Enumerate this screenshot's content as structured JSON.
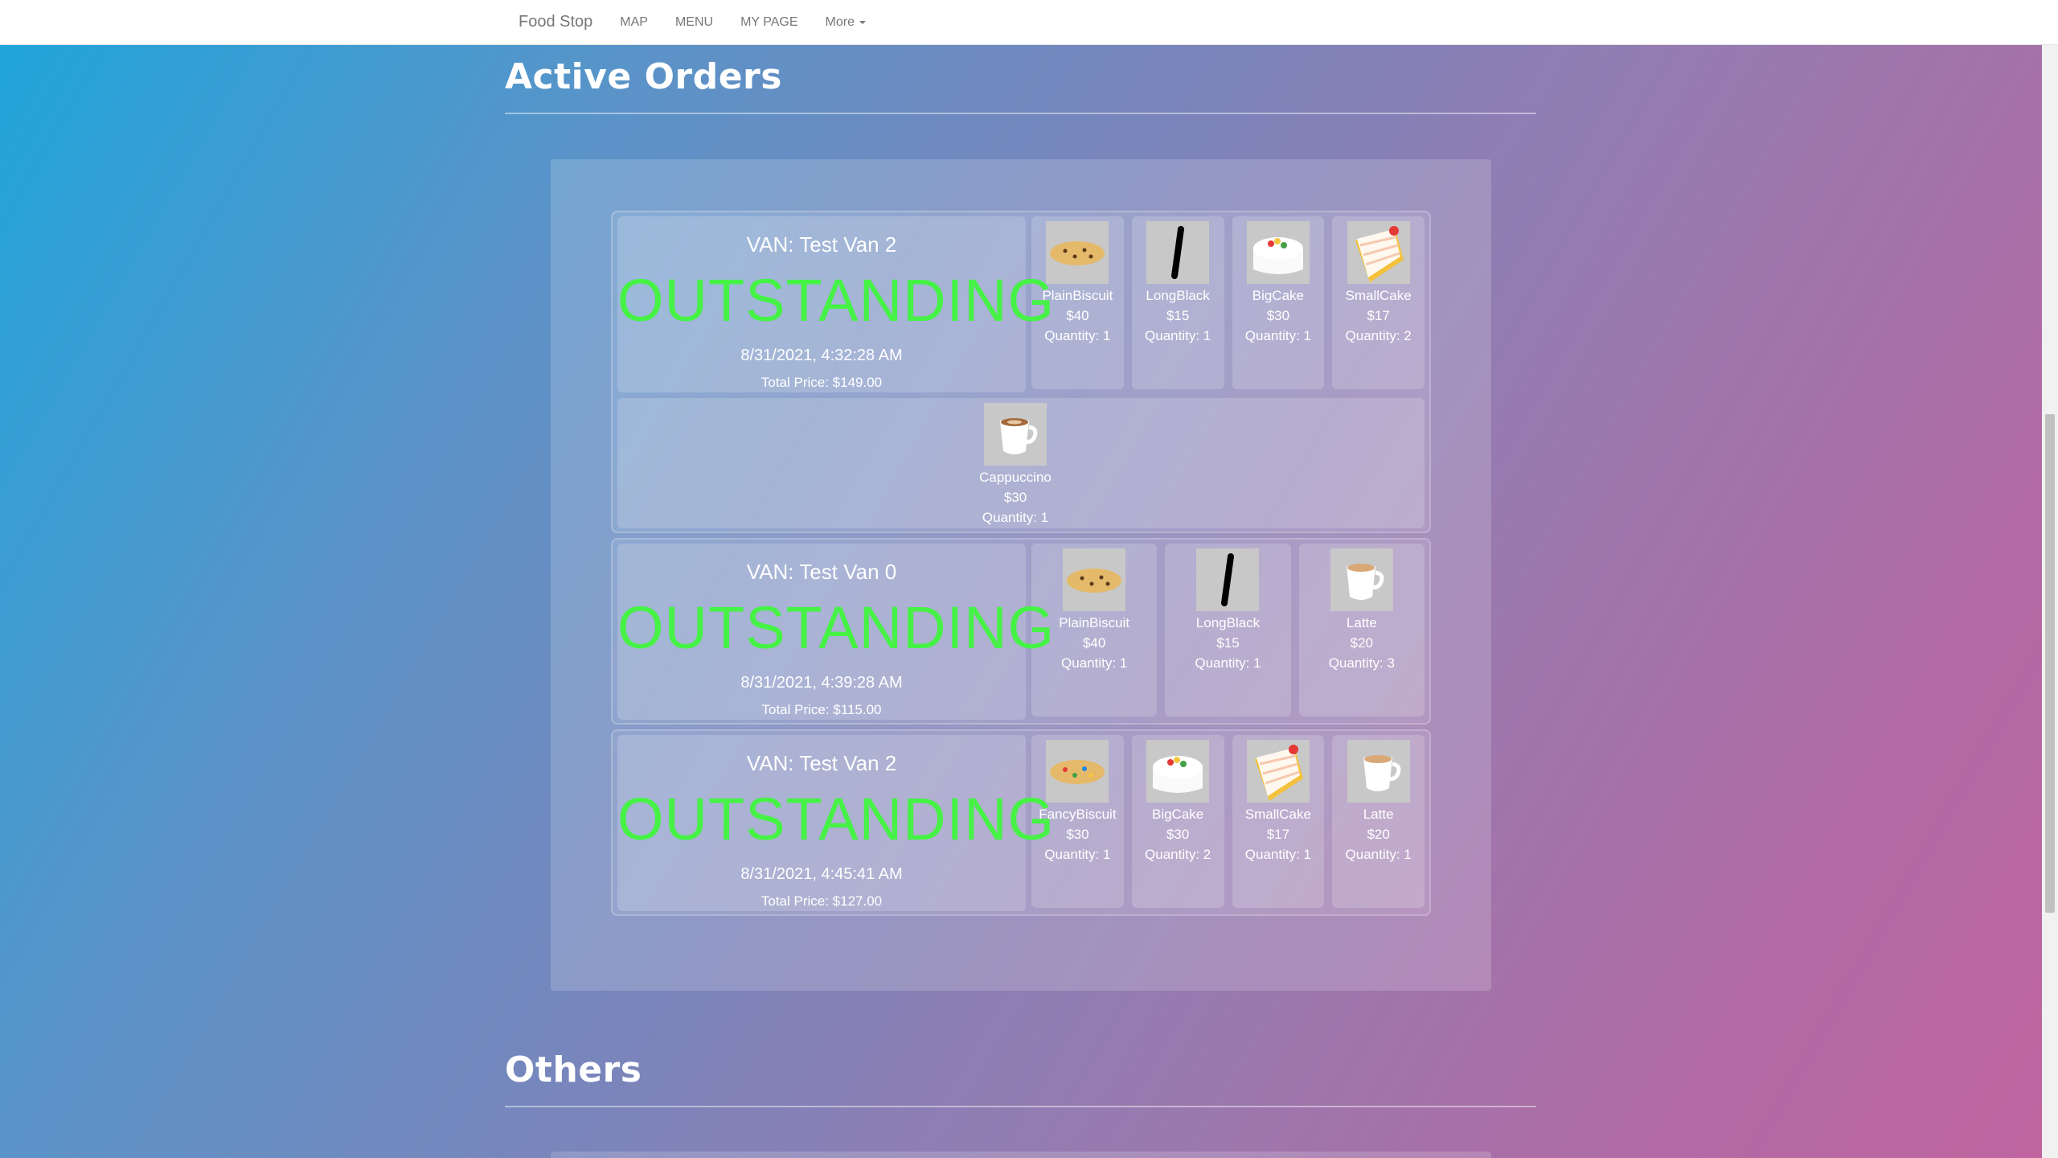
{
  "nav": {
    "brand": "Food Stop",
    "links": [
      "MAP",
      "MENU",
      "MY PAGE"
    ],
    "more": "More"
  },
  "sections": {
    "active": "Active Orders",
    "others": "Others"
  },
  "orders": [
    {
      "van": "VAN: Test Van 2",
      "status": "OUTSTANDING",
      "date": "8/31/2021, 4:32:28 AM",
      "total": "Total Price: $149.00",
      "items": [
        {
          "name": "PlainBiscuit",
          "price": "$40",
          "qty": "Quantity: 1",
          "icon": "plain-biscuit-icon"
        },
        {
          "name": "LongBlack",
          "price": "$15",
          "qty": "Quantity: 1",
          "icon": "long-black-icon"
        },
        {
          "name": "BigCake",
          "price": "$30",
          "qty": "Quantity: 1",
          "icon": "big-cake-icon"
        },
        {
          "name": "SmallCake",
          "price": "$17",
          "qty": "Quantity: 2",
          "icon": "small-cake-icon"
        }
      ],
      "extra_items": [
        {
          "name": "Cappuccino",
          "price": "$30",
          "qty": "Quantity: 1",
          "icon": "cappuccino-icon"
        }
      ]
    },
    {
      "van": "VAN: Test Van 0",
      "status": "OUTSTANDING",
      "date": "8/31/2021, 4:39:28 AM",
      "total": "Total Price: $115.00",
      "items": [
        {
          "name": "PlainBiscuit",
          "price": "$40",
          "qty": "Quantity: 1",
          "icon": "plain-biscuit-icon"
        },
        {
          "name": "LongBlack",
          "price": "$15",
          "qty": "Quantity: 1",
          "icon": "long-black-icon"
        },
        {
          "name": "Latte",
          "price": "$20",
          "qty": "Quantity: 3",
          "icon": "latte-icon"
        }
      ]
    },
    {
      "van": "VAN: Test Van 2",
      "status": "OUTSTANDING",
      "date": "8/31/2021, 4:45:41 AM",
      "total": "Total Price: $127.00",
      "items": [
        {
          "name": "FancyBiscuit",
          "price": "$30",
          "qty": "Quantity: 1",
          "icon": "fancy-biscuit-icon"
        },
        {
          "name": "BigCake",
          "price": "$30",
          "qty": "Quantity: 2",
          "icon": "big-cake-icon"
        },
        {
          "name": "SmallCake",
          "price": "$17",
          "qty": "Quantity: 1",
          "icon": "small-cake-icon"
        },
        {
          "name": "Latte",
          "price": "$20",
          "qty": "Quantity: 1",
          "icon": "latte-icon"
        }
      ]
    }
  ],
  "colors": {
    "status": "#45f245",
    "gradient_start": "#1ea6dc",
    "gradient_end": "#bf649f"
  }
}
